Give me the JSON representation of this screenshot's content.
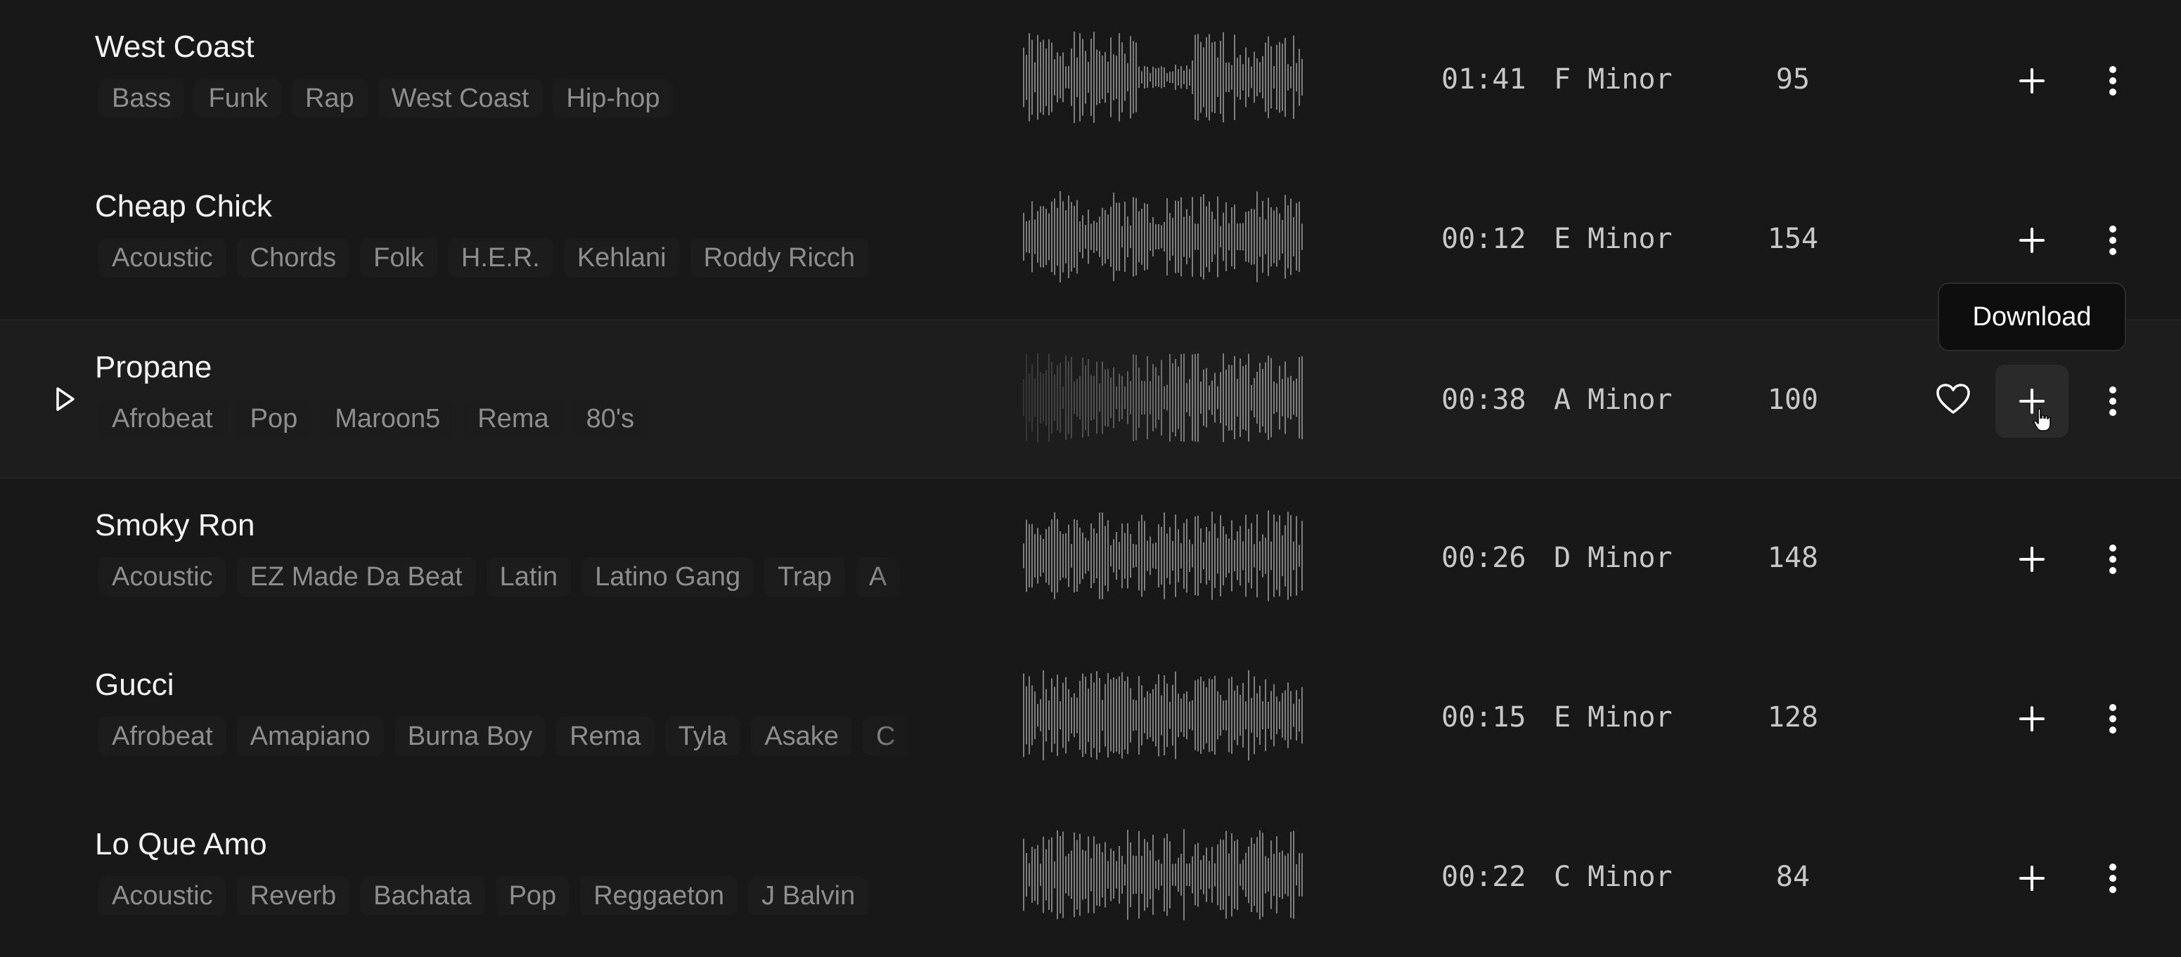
{
  "tracks": [
    {
      "title": "West Coast",
      "tags": [
        "Bass",
        "Funk",
        "Rap",
        "West Coast",
        "Hip-hop"
      ],
      "duration": "01:41",
      "key": "F Minor",
      "bpm": "95"
    },
    {
      "title": "Cheap Chick",
      "tags": [
        "Acoustic",
        "Chords",
        "Folk",
        "H.E.R.",
        "Kehlani",
        "Roddy Ricch"
      ],
      "duration": "00:12",
      "key": "E Minor",
      "bpm": "154"
    },
    {
      "title": "Propane",
      "tags": [
        "Afrobeat",
        "Pop",
        "Maroon5",
        "Rema",
        "80's"
      ],
      "duration": "00:38",
      "key": "A Minor",
      "bpm": "100"
    },
    {
      "title": "Smoky Ron",
      "tags": [
        "Acoustic",
        "EZ Made Da Beat",
        "Latin",
        "Latino Gang",
        "Trap",
        "A"
      ],
      "duration": "00:26",
      "key": "D Minor",
      "bpm": "148"
    },
    {
      "title": "Gucci",
      "tags": [
        "Afrobeat",
        "Amapiano",
        "Burna Boy",
        "Rema",
        "Tyla",
        "Asake",
        "C"
      ],
      "duration": "00:15",
      "key": "E Minor",
      "bpm": "128"
    },
    {
      "title": "Lo Que Amo",
      "tags": [
        "Acoustic",
        "Reverb",
        "Bachata",
        "Pop",
        "Reggaeton",
        "J Balvin"
      ],
      "duration": "00:22",
      "key": "C Minor",
      "bpm": "84"
    }
  ],
  "hovered_index": 2,
  "tooltip": {
    "text": "Download"
  },
  "icons": {
    "play": "play-icon",
    "like": "heart-icon",
    "add": "plus-icon",
    "more": "more-vertical-icon",
    "cursor": "hand-pointer-icon"
  },
  "colors": {
    "background": "#181818",
    "hover_row": "#1d1d1d",
    "tag_background": "#1c1c1c",
    "tag_text": "#8e8e8e",
    "waveform": "#8a8a8a",
    "tooltip_background": "#0e0e0e"
  }
}
